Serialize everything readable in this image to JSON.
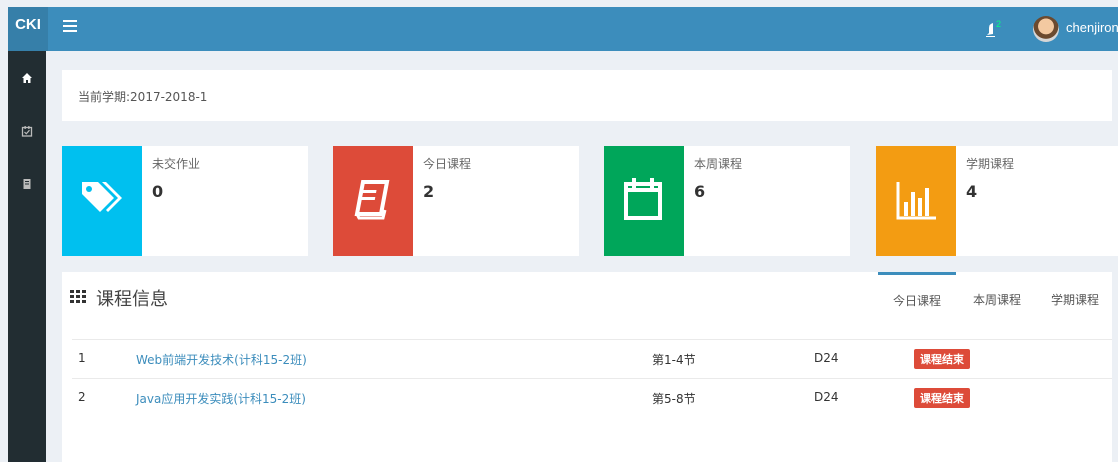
{
  "header": {
    "logo": "CKI",
    "username": "chenjirong",
    "notification_badge": "2"
  },
  "semester": {
    "text": "当前学期:2017-2018-1"
  },
  "stats": [
    {
      "label": "未交作业",
      "value": "0",
      "color": "#00c0ef",
      "icon": "tags-icon"
    },
    {
      "label": "今日课程",
      "value": "2",
      "color": "#dd4b39",
      "icon": "book-icon"
    },
    {
      "label": "本周课程",
      "value": "6",
      "color": "#00a65a",
      "icon": "calendar-icon"
    },
    {
      "label": "学期课程",
      "value": "4",
      "color": "#f39c12",
      "icon": "bar-chart-icon"
    }
  ],
  "course_info": {
    "title": "课程信息",
    "tabs": [
      "今日课程",
      "本周课程",
      "学期课程"
    ],
    "rows": [
      {
        "no": "1",
        "name": "Web前端开发技术(计科15-2班)",
        "period": "第1-4节",
        "room": "D24",
        "status": "课程结束"
      },
      {
        "no": "2",
        "name": "Java应用开发实践(计科15-2班)",
        "period": "第5-8节",
        "room": "D24",
        "status": "课程结束"
      }
    ]
  },
  "colors": {
    "header": "#3c8dbc",
    "sidebar": "#222d32",
    "status": "#dd4b39"
  }
}
